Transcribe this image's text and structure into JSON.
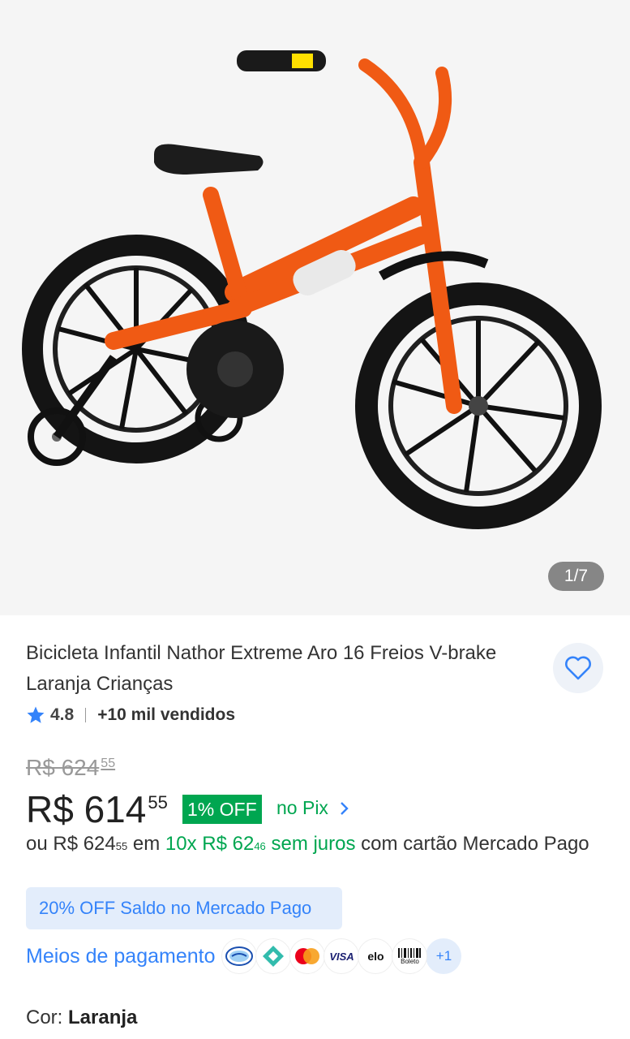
{
  "gallery": {
    "counter": "1/7",
    "image_alt": "bicicleta laranja"
  },
  "product": {
    "title": "Bicicleta Infantil Nathor Extreme Aro 16 Freios V-brake Laranja Crianças",
    "rating": "4.8",
    "sold": "+10 mil vendidos"
  },
  "pricing": {
    "old_price_main": "R$ 624",
    "old_price_cents": "55",
    "price_main": "R$ 614",
    "price_cents": "55",
    "discount_badge": "1% OFF",
    "pix_label": "no Pix",
    "installments": {
      "prefix": "ou R$ 624",
      "prefix_cents": "55",
      "em": "em",
      "plan": "10x R$ 62",
      "plan_cents": "46",
      "no_interest": "sem juros",
      "suffix": "com cartão Mercado Pago"
    }
  },
  "promo": {
    "label": "20% OFF Saldo no Mercado Pago"
  },
  "payment": {
    "link": "Meios de pagamento",
    "methods": [
      {
        "name": "mercado-pago-icon"
      },
      {
        "name": "pix-icon"
      },
      {
        "name": "mastercard-icon"
      },
      {
        "name": "visa-icon",
        "text": "VISA"
      },
      {
        "name": "elo-icon",
        "text": "elo"
      },
      {
        "name": "boleto-icon",
        "text": "Boleto"
      }
    ],
    "more": "+1"
  },
  "color": {
    "label": "Cor:",
    "value": "Laranja"
  },
  "colors": {
    "accent": "#3483fa",
    "green": "#00a650",
    "bike_orange": "#f05a14"
  }
}
